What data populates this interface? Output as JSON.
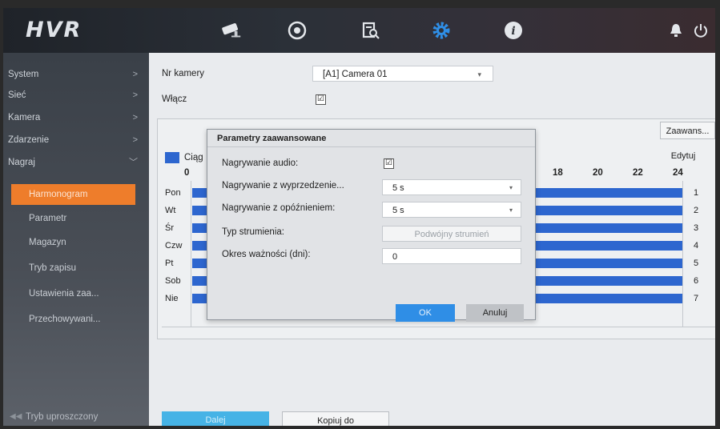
{
  "app": {
    "logo": "HVR"
  },
  "topbar": {
    "icons": [
      "camera-icon",
      "playback-icon",
      "search-icon",
      "settings-gear-icon",
      "info-icon",
      "alarm-bell-icon",
      "power-icon"
    ],
    "active_color": "#2f8ee6"
  },
  "sidebar": {
    "items": [
      {
        "label": "System",
        "arrow": ">"
      },
      {
        "label": "Sieć",
        "arrow": ">"
      },
      {
        "label": "Kamera",
        "arrow": ">"
      },
      {
        "label": "Zdarzenie",
        "arrow": ">"
      },
      {
        "label": "Nagraj",
        "arrow": "﹀"
      }
    ],
    "subitems": [
      {
        "label": "Harmonogram",
        "active": true
      },
      {
        "label": "Parametr"
      },
      {
        "label": "Magazyn"
      },
      {
        "label": "Tryb zapisu"
      },
      {
        "label": "Ustawienia zaa..."
      },
      {
        "label": "Przechowywani..."
      }
    ],
    "bottom_label": "Tryb uproszczony",
    "active_color": "#ee7d2b"
  },
  "main": {
    "camera_label": "Nr kamery",
    "camera_value": "[A1] Camera 01",
    "enable_label": "Włącz",
    "enable_checked": "☑",
    "advanced_button": "Zaawans...",
    "edit_button": "Edytuj",
    "legend_label": "Ciąg",
    "hours_left": [
      "0"
    ],
    "hours_right": [
      "18",
      "20",
      "22",
      "24"
    ],
    "days": [
      "Pon",
      "Wt",
      "Śr",
      "Czw",
      "Pt",
      "Sob",
      "Nie"
    ],
    "day_numbers": [
      "1",
      "2",
      "3",
      "4",
      "5",
      "6",
      "7"
    ],
    "bar_color": "#2d66cf",
    "next_button": "Dalej",
    "copy_button": "Kopiuj do"
  },
  "modal": {
    "title": "Parametry zaawansowane",
    "audio_label": "Nagrywanie audio:",
    "audio_checked": "☑",
    "pre_label": "Nagrywanie z wyprzedzenie...",
    "pre_value": "5 s",
    "post_label": "Nagrywanie z opóźnieniem:",
    "post_value": "5 s",
    "stream_label": "Typ strumienia:",
    "stream_value": "Podwójny strumień",
    "expire_label": "Okres ważności (dni):",
    "expire_value": "0",
    "ok_button": "OK",
    "cancel_button": "Anuluj"
  }
}
